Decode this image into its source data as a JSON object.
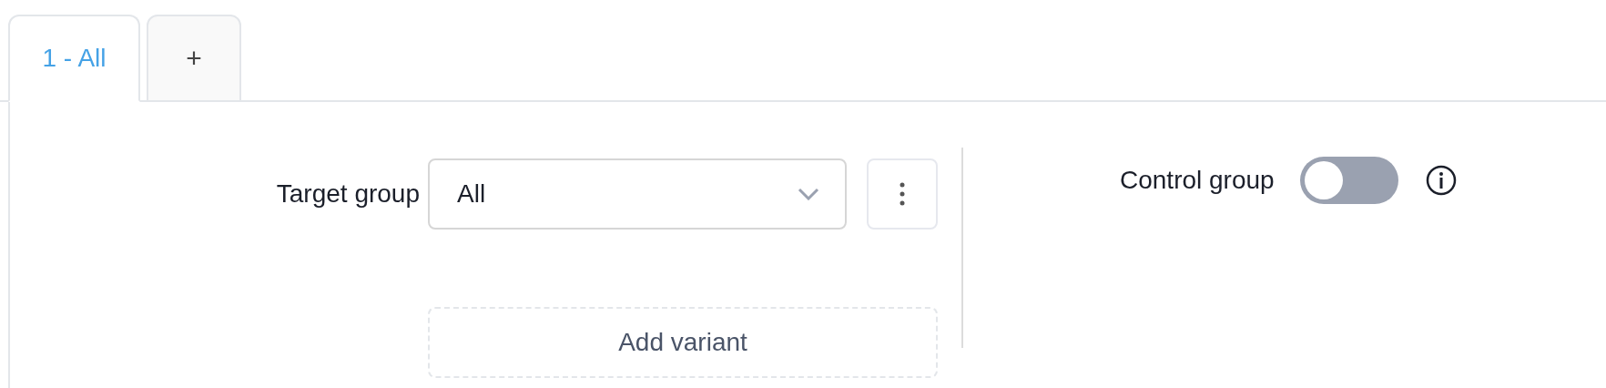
{
  "tabs": [
    {
      "label": "1 - All",
      "selected": true
    },
    {
      "label": "+",
      "selected": false
    }
  ],
  "target_group": {
    "label": "Target group",
    "value": "All"
  },
  "add_variant": {
    "label": "Add variant"
  },
  "control_group": {
    "label": "Control group",
    "on": false
  }
}
